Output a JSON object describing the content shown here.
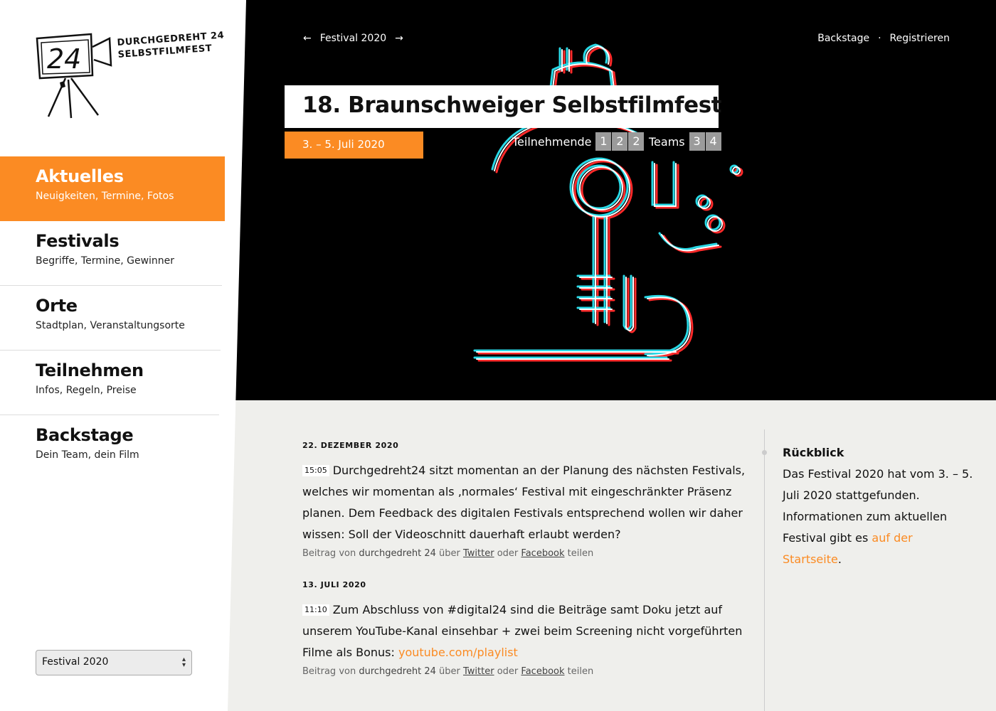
{
  "logo": {
    "number": "24",
    "line1": "DURCHGEDREHT 24",
    "line2": "SELBSTFILMFEST"
  },
  "nav": [
    {
      "title": "Aktuelles",
      "sub": "Neuigkeiten, Termine, Fotos"
    },
    {
      "title": "Festivals",
      "sub": "Begriffe, Termine, Gewinner"
    },
    {
      "title": "Orte",
      "sub": "Stadtplan, Veranstaltungsorte"
    },
    {
      "title": "Teilnehmen",
      "sub": "Infos, Regeln, Preise"
    },
    {
      "title": "Backstage",
      "sub": "Dein Team, dein Film"
    }
  ],
  "festival_select": {
    "value": "Festival 2020"
  },
  "topnav": {
    "prev_arrow": "←",
    "festival": "Festival 2020",
    "next_arrow": "→",
    "backstage": "Backstage",
    "separator": "·",
    "register": "Registrieren"
  },
  "hero": {
    "title": "18. Braunschweiger Selbstfilmfest",
    "dates": "3. – 5. Juli 2020",
    "participants_label": "Teilnehmende",
    "participants_digits": [
      "1",
      "2",
      "2"
    ],
    "teams_label": "Teams",
    "teams_digits": [
      "3",
      "4"
    ]
  },
  "posts": [
    {
      "date": "22. DEZEMBER 2020",
      "time": "15:05",
      "text": "Durchgedreht24 sitzt momentan an der Planung des nächsten Festivals, welches wir momentan als ‚normales‘ Festival mit eingeschränkter Präsenz planen. Dem Feedback des digitalen Festivals entsprechend wollen wir daher wissen: Soll der Videoschnitt dauerhaft erlaubt werden?",
      "link": "",
      "share": {
        "prefix": "Beitrag von",
        "author": "durchgedreht 24",
        "via": "über",
        "twitter": "Twitter",
        "or": "oder",
        "facebook": "Facebook",
        "suffix": "teilen"
      }
    },
    {
      "date": "13. JULI 2020",
      "time": "11:10",
      "text": "Zum Abschluss von #digital24 sind die Beiträge samt Doku jetzt auf unserem YouTube-Kanal einsehbar + zwei beim Screening nicht vorgeführten Filme als Bonus: ",
      "link": "youtube.com/playlist",
      "share": {
        "prefix": "Beitrag von",
        "author": "durchgedreht 24",
        "via": "über",
        "twitter": "Twitter",
        "or": "oder",
        "facebook": "Facebook",
        "suffix": "teilen"
      }
    }
  ],
  "aside": {
    "title": "Rückblick",
    "text": "Das Festival 2020 hat vom 3. – 5. Juli 2020 stattgefunden. Informationen zum aktuellen Festival gibt es ",
    "link": "auf der Startseite",
    "end": "."
  },
  "colors": {
    "accent": "#fb8b23",
    "hero_bg": "#000000",
    "content_bg": "#efefec"
  }
}
